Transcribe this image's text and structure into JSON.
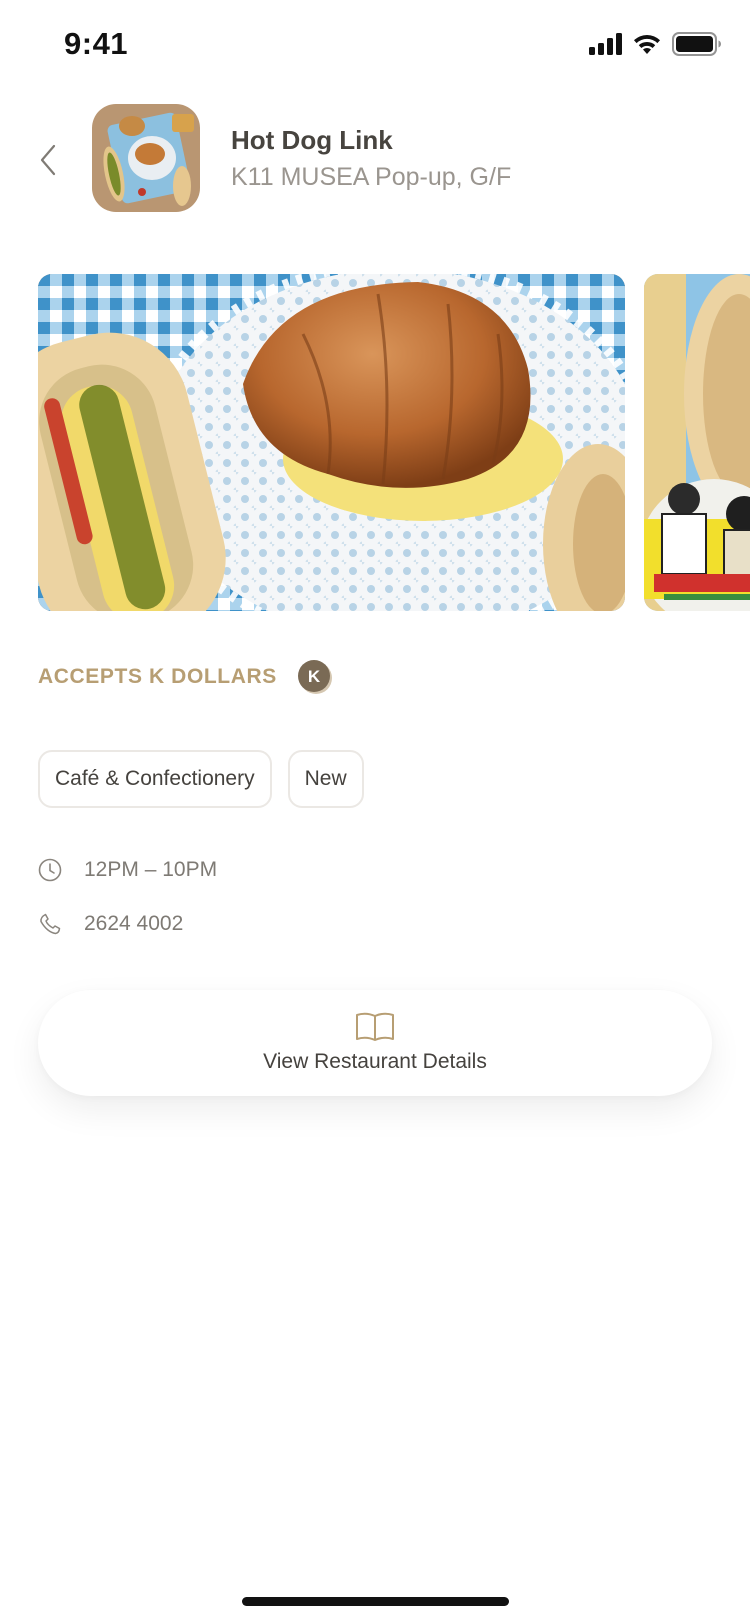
{
  "status_bar": {
    "time": "9:41"
  },
  "header": {
    "back_icon": "chevron-left-icon",
    "avatar_icon": "restaurant-thumbnail",
    "name": "Hot Dog Link",
    "location": "K11 MUSEA Pop-up, G/F"
  },
  "gallery": {
    "photos": [
      "croissant-photo",
      "hotdog-logo-photo"
    ]
  },
  "accepts": {
    "label": "ACCEPTS K DOLLARS",
    "badge_letter": "K"
  },
  "tags": [
    "Café & Confectionery",
    "New"
  ],
  "info": {
    "hours": "12PM – 10PM",
    "phone": "2624 4002"
  },
  "details_button": {
    "label": "View Restaurant Details",
    "icon": "book-icon"
  },
  "colors": {
    "gold": "#b79e73",
    "badge_brown": "#7a6a55",
    "text_dark": "#47443f",
    "text_muted": "#9a958f"
  }
}
